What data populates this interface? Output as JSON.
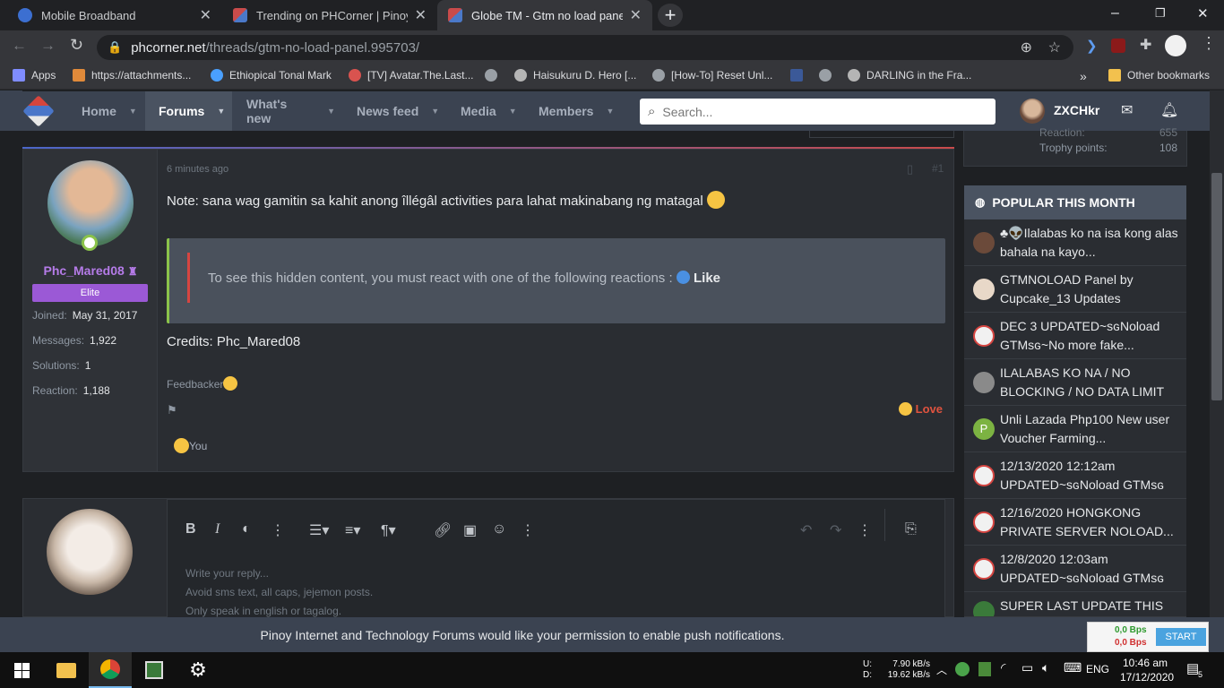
{
  "tabs": [
    {
      "title": "Mobile Broadband",
      "color": "#3c6fd1"
    },
    {
      "title": "Trending on PHCorner | Pinoy Int",
      "color": "#c94b4b"
    },
    {
      "title": "Globe TM - Gtm no load panel | P",
      "color": "#c94b4b"
    }
  ],
  "new_tab": "+",
  "window": {
    "minimize": "–",
    "maximize": "❐",
    "close": "✕"
  },
  "address": {
    "host": "phcorner.net",
    "path": "/threads/gtm-no-load-panel.995703/"
  },
  "bookmarks": [
    {
      "label": "Apps",
      "color": "#7f8cff"
    },
    {
      "label": "https://attachments...",
      "color": "#e08a3a"
    },
    {
      "label": "Ethiopical Tonal Mark",
      "color": "#4aa0ff"
    },
    {
      "label": "[TV] Avatar.The.Last...",
      "color": "#d9534f"
    },
    {
      "label": "",
      "color": "#9aa0a6"
    },
    {
      "label": "Haisukuru D. Hero [...",
      "color": "#b5b5b5"
    },
    {
      "label": "[How-To] Reset Unl...",
      "color": "#9aa0a6"
    },
    {
      "label": "",
      "color": "#3b5998"
    },
    {
      "label": "",
      "color": "#9aa0a6"
    },
    {
      "label": "DARLING in the Fra...",
      "color": "#b5b5b5"
    }
  ],
  "bookmarks_more": "»",
  "other_bookmarks": "Other bookmarks",
  "nav": {
    "home": "Home",
    "forums": "Forums",
    "whats_new": "What's new",
    "news_feed": "News feed",
    "media": "Media",
    "members": "Members",
    "search_placeholder": "Search...",
    "username": "ZXCHkr"
  },
  "post": {
    "time": "6 minutes ago",
    "number": "#1",
    "note": "Note: sana wag gamitin sa kahit anong îllégâl activities para lahat makinabang ng matagal",
    "hidden_prefix": "To see this hidden content, you must react with one of the following reactions :",
    "hidden_reaction": "Like",
    "credits": "Credits: Phc_Mared08",
    "feedbacker": "Feedbacker",
    "love": "Love",
    "reacted_by": "You"
  },
  "author": {
    "name": "Phc_Mared08",
    "badge": "Elite",
    "joined_label": "Joined:",
    "joined": "May 31, 2017",
    "messages_label": "Messages:",
    "messages": "1,922",
    "solutions_label": "Solutions:",
    "solutions": "1",
    "reaction_label": "Reaction:",
    "reaction": "1,188"
  },
  "my_stats": {
    "reaction_label": "Reaction:",
    "reaction": "655",
    "trophy_label": "Trophy points:",
    "trophy": "108"
  },
  "popular": {
    "title": "POPULAR THIS MONTH",
    "items": [
      {
        "title": "♣👽Ilalabas ko na isa kong alas bahala na kayo...",
        "color": "#6b4a3a"
      },
      {
        "title": "GTMNOLOAD Panel by Cupcake_13 Updates",
        "color": "#e8d8c8"
      },
      {
        "title": "DEC 3 UPDATED~ѕɢNoload GTMѕɢ~No more fake...",
        "color": "#f1f1f1"
      },
      {
        "title": "ILALABAS KO NA / NO BLOCKING / NO DATA LIMIT",
        "color": "#8a8a8a"
      },
      {
        "title": "Unli Lazada Php100 New user Voucher Farming...",
        "color": "#7cb342"
      },
      {
        "title": "12/13/2020 12:12am UPDATED~ѕɢNoload GTMѕɢ",
        "color": "#f1f1f1"
      },
      {
        "title": "12/16/2020 HONGKONG PRIVATE SERVER NOLOAD...",
        "color": "#f1f1f1"
      },
      {
        "title": "12/8/2020 12:03am UPDATED~ѕɢNoload GTMѕɢ",
        "color": "#f1f1f1"
      },
      {
        "title": "SUPER LAST UPDATE THIS",
        "color": "#3a7a3a"
      }
    ]
  },
  "editor": {
    "placeholder1": "Write your reply...",
    "placeholder2": "Avoid sms text, all caps, jejemon posts.",
    "placeholder3": "Only speak in english or tagalog."
  },
  "push_banner": "Pinoy Internet and Technology Forums would like your permission to enable push notifications.",
  "speed": {
    "up": "0,0 Bps",
    "down": "0,0 Bps",
    "start": "START"
  },
  "taskbar": {
    "net_u_label": "U:",
    "net_u": "7.90 kB/s",
    "net_d_label": "D:",
    "net_d": "19.62 kB/s",
    "lang": "ENG",
    "time": "10:46 am",
    "date": "17/12/2020",
    "notif_count": "5"
  },
  "colors": {
    "accent": "#5e9cf0",
    "nav_bg": "#3b4351",
    "username": "#b57be8",
    "badge": "#9b59d6",
    "love": "#e0533f",
    "green": "#8bc34a"
  }
}
